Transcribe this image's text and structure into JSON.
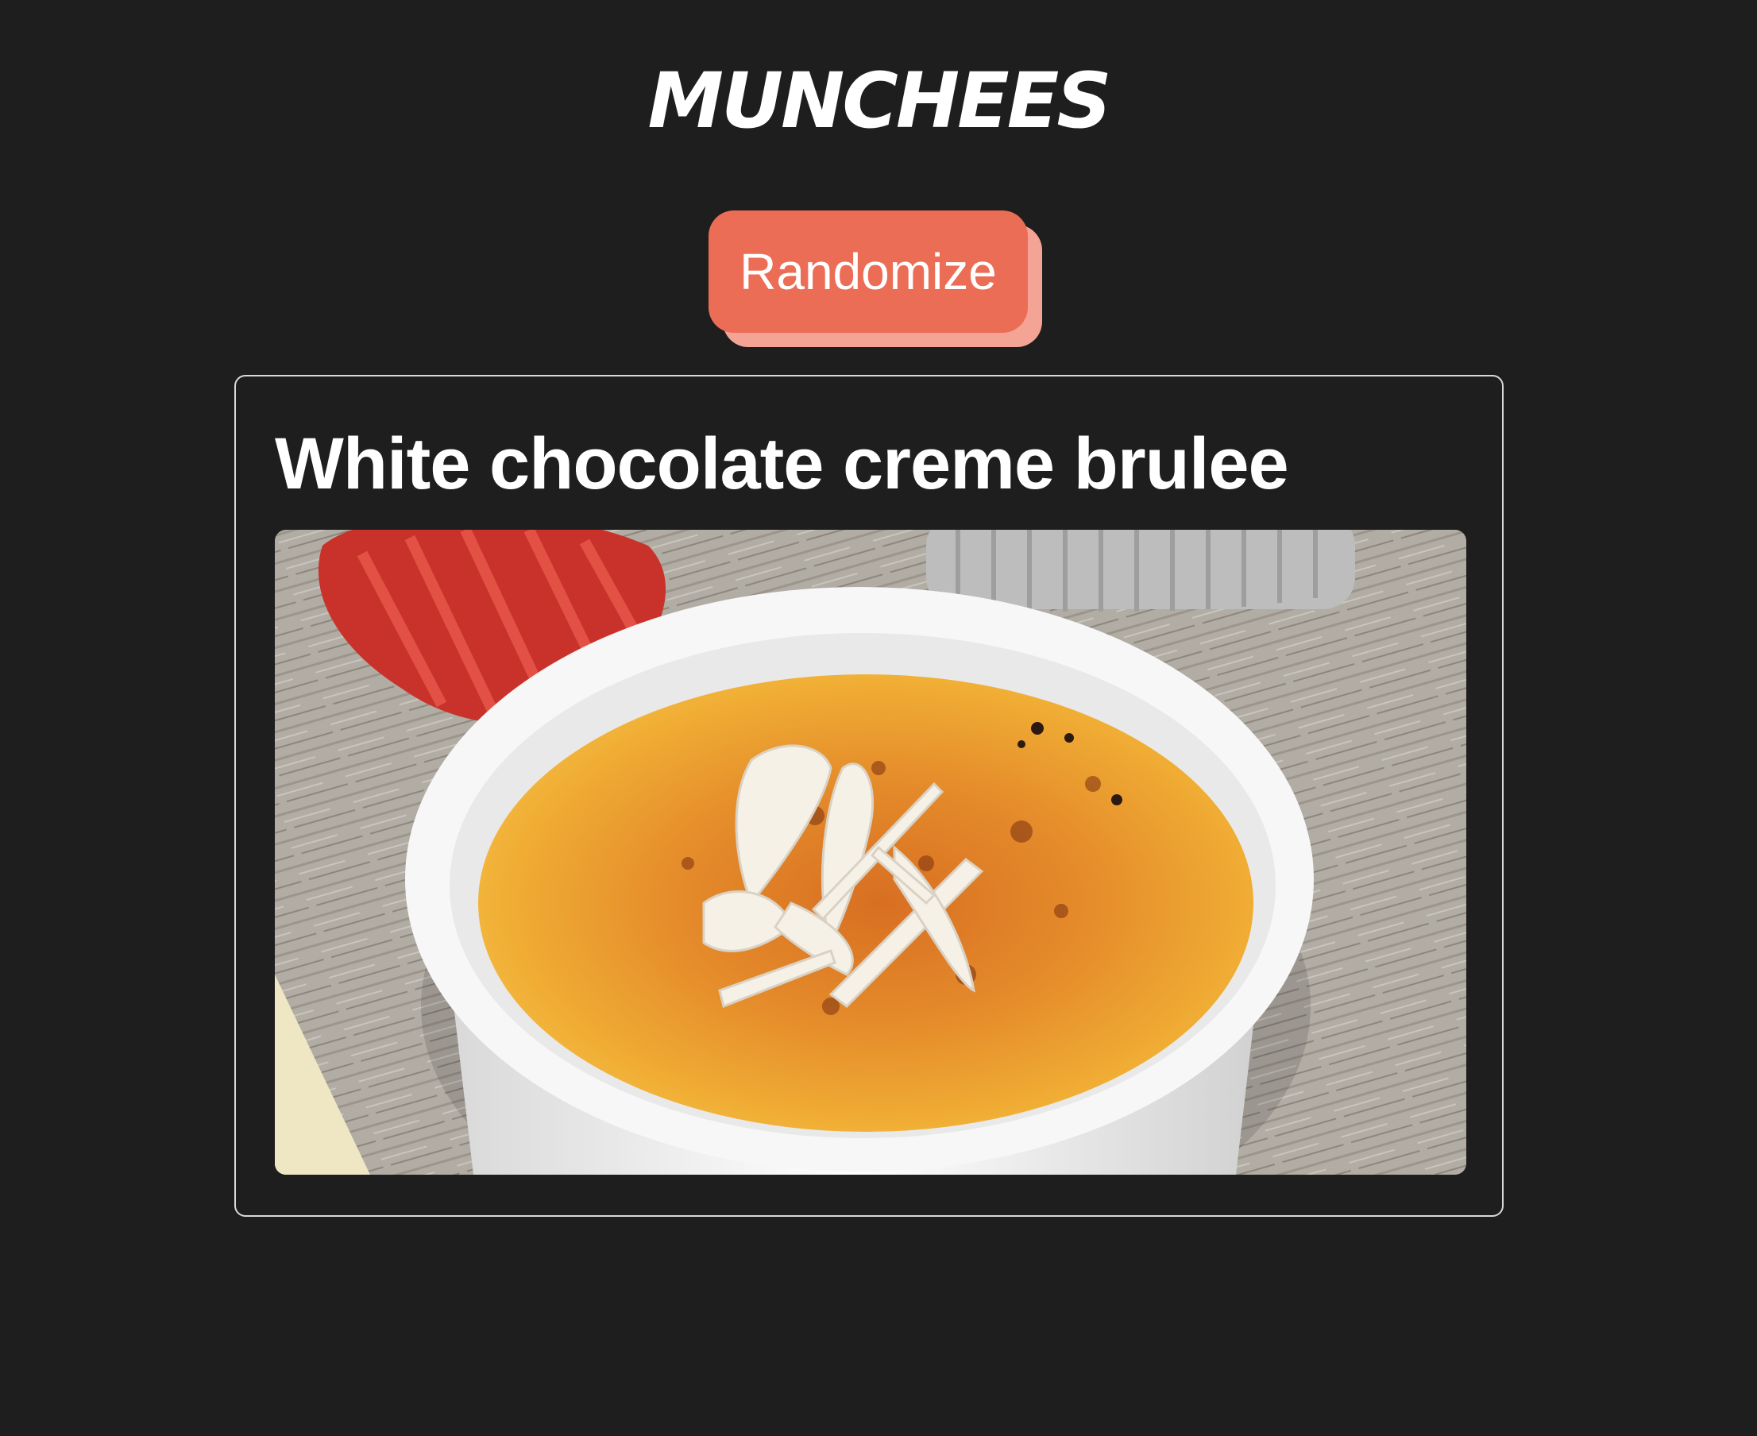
{
  "app": {
    "brand_name": "MUNCHEES"
  },
  "controls": {
    "randomize_label": "Randomize"
  },
  "recipe": {
    "title": "White chocolate creme brulee",
    "image_alt": "White chocolate creme brulee"
  },
  "colors": {
    "background": "#1e1e1e",
    "button": "#ec6d55",
    "button_shadow": "#f4a494",
    "card_border": "#d9d9d9",
    "text": "#ffffff"
  }
}
